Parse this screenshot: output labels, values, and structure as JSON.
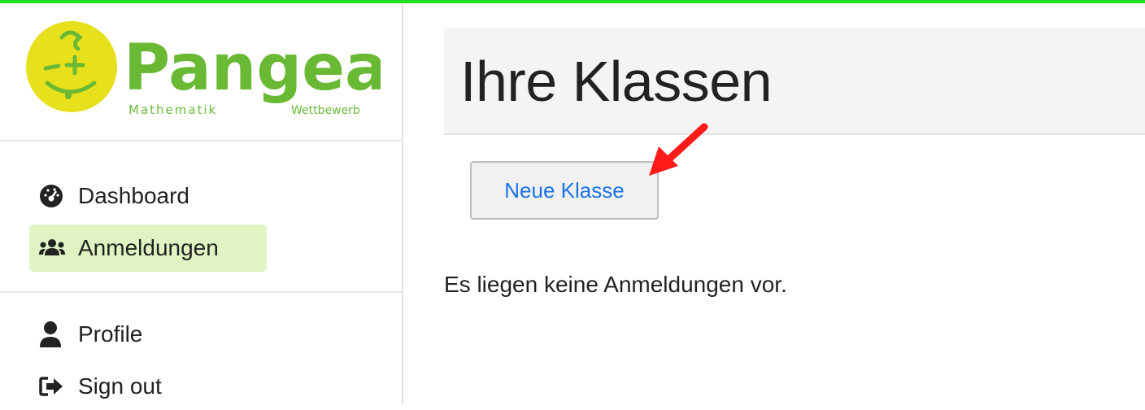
{
  "logo": {
    "name": "Pangea",
    "left_word": "Mathematik",
    "right_word": "Wettbewerb"
  },
  "sidebar": {
    "items": [
      {
        "label": "Dashboard",
        "icon": "dashboard-icon"
      },
      {
        "label": "Anmeldungen",
        "icon": "users-icon",
        "active": true
      },
      {
        "label": "Profile",
        "icon": "user-icon"
      },
      {
        "label": "Sign out",
        "icon": "sign-out-icon"
      }
    ]
  },
  "main": {
    "title": "Ihre Klassen",
    "new_class_button": "Neue Klasse",
    "empty_message": "Es liegen keine Anmeldungen vor."
  },
  "colors": {
    "top_bar": "#22dd22",
    "active_item_bg": "#dff4c2",
    "button_text": "#1a73e8",
    "logo_green": "#6ab935",
    "logo_yellow": "#e7e01c",
    "annotation_arrow": "#ff1a1a"
  }
}
